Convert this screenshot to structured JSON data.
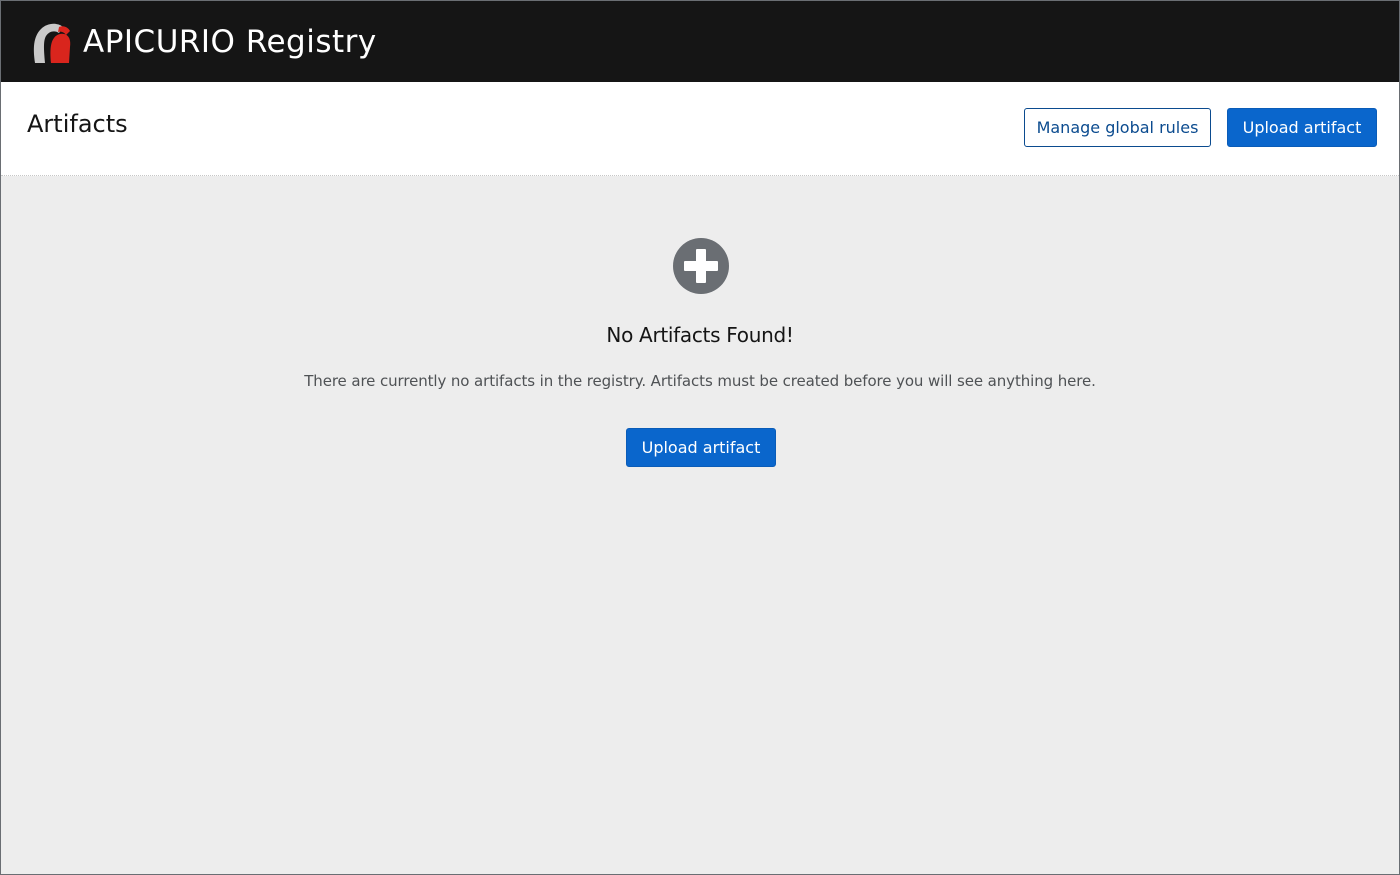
{
  "masthead": {
    "brand": "APICURIO Registry",
    "logo_icon": "apicurio-logo-icon"
  },
  "header": {
    "title": "Artifacts",
    "manage_rules_label": "Manage global rules",
    "upload_label": "Upload artifact"
  },
  "empty_state": {
    "icon": "plus-circle-icon",
    "title": "No Artifacts Found!",
    "body": "There are currently no artifacts in the registry. Artifacts must be created before you will see anything here.",
    "upload_label": "Upload artifact"
  },
  "colors": {
    "masthead_bg": "#151515",
    "primary": "#0a66cc",
    "secondary_border": "#0b4b8f",
    "page_bg": "#ededed"
  }
}
